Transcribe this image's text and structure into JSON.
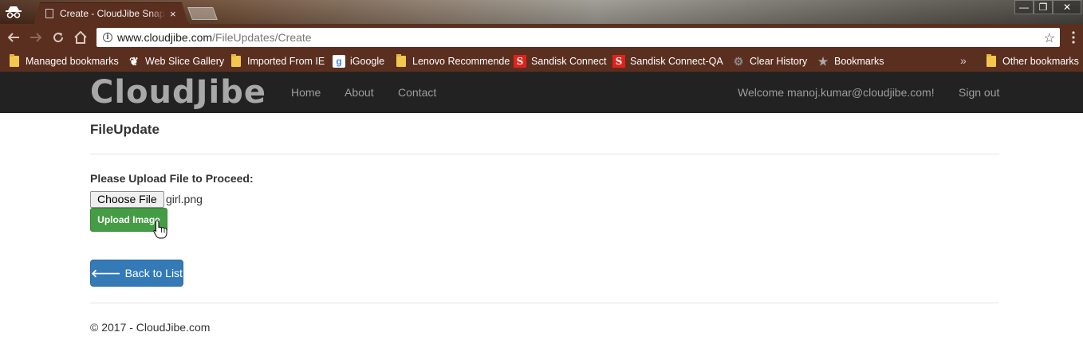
{
  "browser": {
    "tab_title": "Create - CloudJibe Snapl",
    "tab_close": "×",
    "window_controls": {
      "minimize": "—",
      "restore": "❐",
      "close": "✕"
    },
    "url_host": "www.cloudjibe.com",
    "url_path": "/FileUpdates/Create",
    "bookmarks": [
      {
        "label": "Managed bookmarks",
        "icon": "folder-icon"
      },
      {
        "label": "Web Slice Gallery",
        "icon": "web-slice-icon"
      },
      {
        "label": "Imported From IE",
        "icon": "folder-icon"
      },
      {
        "label": "iGoogle",
        "icon": "google-icon"
      },
      {
        "label": "Lenovo Recommende",
        "icon": "folder-icon"
      },
      {
        "label": "Sandisk Connect",
        "icon": "sandisk-icon"
      },
      {
        "label": "Sandisk Connect-QA",
        "icon": "sandisk-icon"
      },
      {
        "label": "Clear History",
        "icon": "gear-icon"
      },
      {
        "label": "Bookmarks",
        "icon": "star-icon"
      }
    ],
    "more_bookmarks": "»",
    "other_bookmarks": "Other bookmarks"
  },
  "site": {
    "brand": "CloudJibe",
    "nav": [
      "Home",
      "About",
      "Contact"
    ],
    "welcome": "Welcome manoj.kumar@cloudjibe.com!",
    "sign_out": "Sign out"
  },
  "main": {
    "title": "FileUpdate",
    "upload_label": "Please Upload File to Proceed:",
    "choose_file": "Choose File",
    "file_name": "girl.png",
    "upload_button": "Upload Image",
    "back_button": "Back to List"
  },
  "footer": {
    "text": "© 2017 - CloudJibe.com"
  },
  "colors": {
    "chrome": "#5b2f1f",
    "navbar": "#222222",
    "success": "#449d44",
    "primary": "#337ab7"
  }
}
